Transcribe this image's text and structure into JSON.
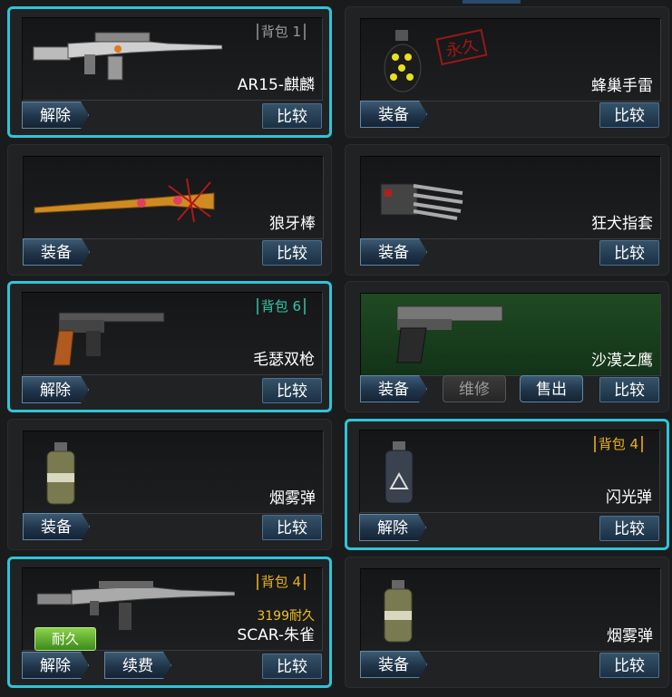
{
  "items": [
    {
      "name": "AR15-麒麟",
      "tag": "背包 1",
      "tag_style": "gray",
      "selected": true,
      "icon": "rifle-icon",
      "actions": [
        "解除"
      ],
      "compare": "比较"
    },
    {
      "name": "蜂巢手雷",
      "stamp": "永久",
      "selected": false,
      "icon": "grenade-icon",
      "actions": [
        "装备"
      ],
      "compare": "比较"
    },
    {
      "name": "狼牙棒",
      "selected": false,
      "icon": "bat-icon",
      "actions": [
        "装备"
      ],
      "compare": "比较"
    },
    {
      "name": "狂犬指套",
      "selected": false,
      "icon": "claw-icon",
      "actions": [
        "装备"
      ],
      "compare": "比较"
    },
    {
      "name": "毛瑟双枪",
      "tag": "背包 6",
      "tag_style": "teal",
      "selected": true,
      "icon": "pistol-icon",
      "actions": [
        "解除"
      ],
      "compare": "比较"
    },
    {
      "name": "沙漠之鹰",
      "selected": false,
      "icon": "pistol-icon",
      "actions": [
        "装备",
        "维修",
        "售出"
      ],
      "compare": "比较",
      "green": true
    },
    {
      "name": "烟雾弹",
      "selected": false,
      "icon": "smoke-grenade-icon",
      "actions": [
        "装备"
      ],
      "compare": "比较"
    },
    {
      "name": "闪光弹",
      "tag": "背包 4",
      "tag_style": "gold",
      "selected": true,
      "icon": "flash-grenade-icon",
      "actions": [
        "解除"
      ],
      "compare": "比较"
    },
    {
      "name": "SCAR-朱雀",
      "tag": "背包 4",
      "tag_style": "gold",
      "durability": "3199耐久",
      "badge": "耐久",
      "selected": true,
      "icon": "rifle-icon",
      "actions": [
        "解除",
        "续费"
      ],
      "compare": "比较"
    },
    {
      "name": "烟雾弹",
      "selected": false,
      "icon": "smoke-grenade-icon",
      "actions": [
        "装备"
      ],
      "compare": "比较"
    }
  ],
  "colors": {
    "selected_border": "#2fc4d8",
    "tag_gold": "#e8b21a",
    "tag_teal": "#33c6a7",
    "durability": "#f0c020"
  }
}
